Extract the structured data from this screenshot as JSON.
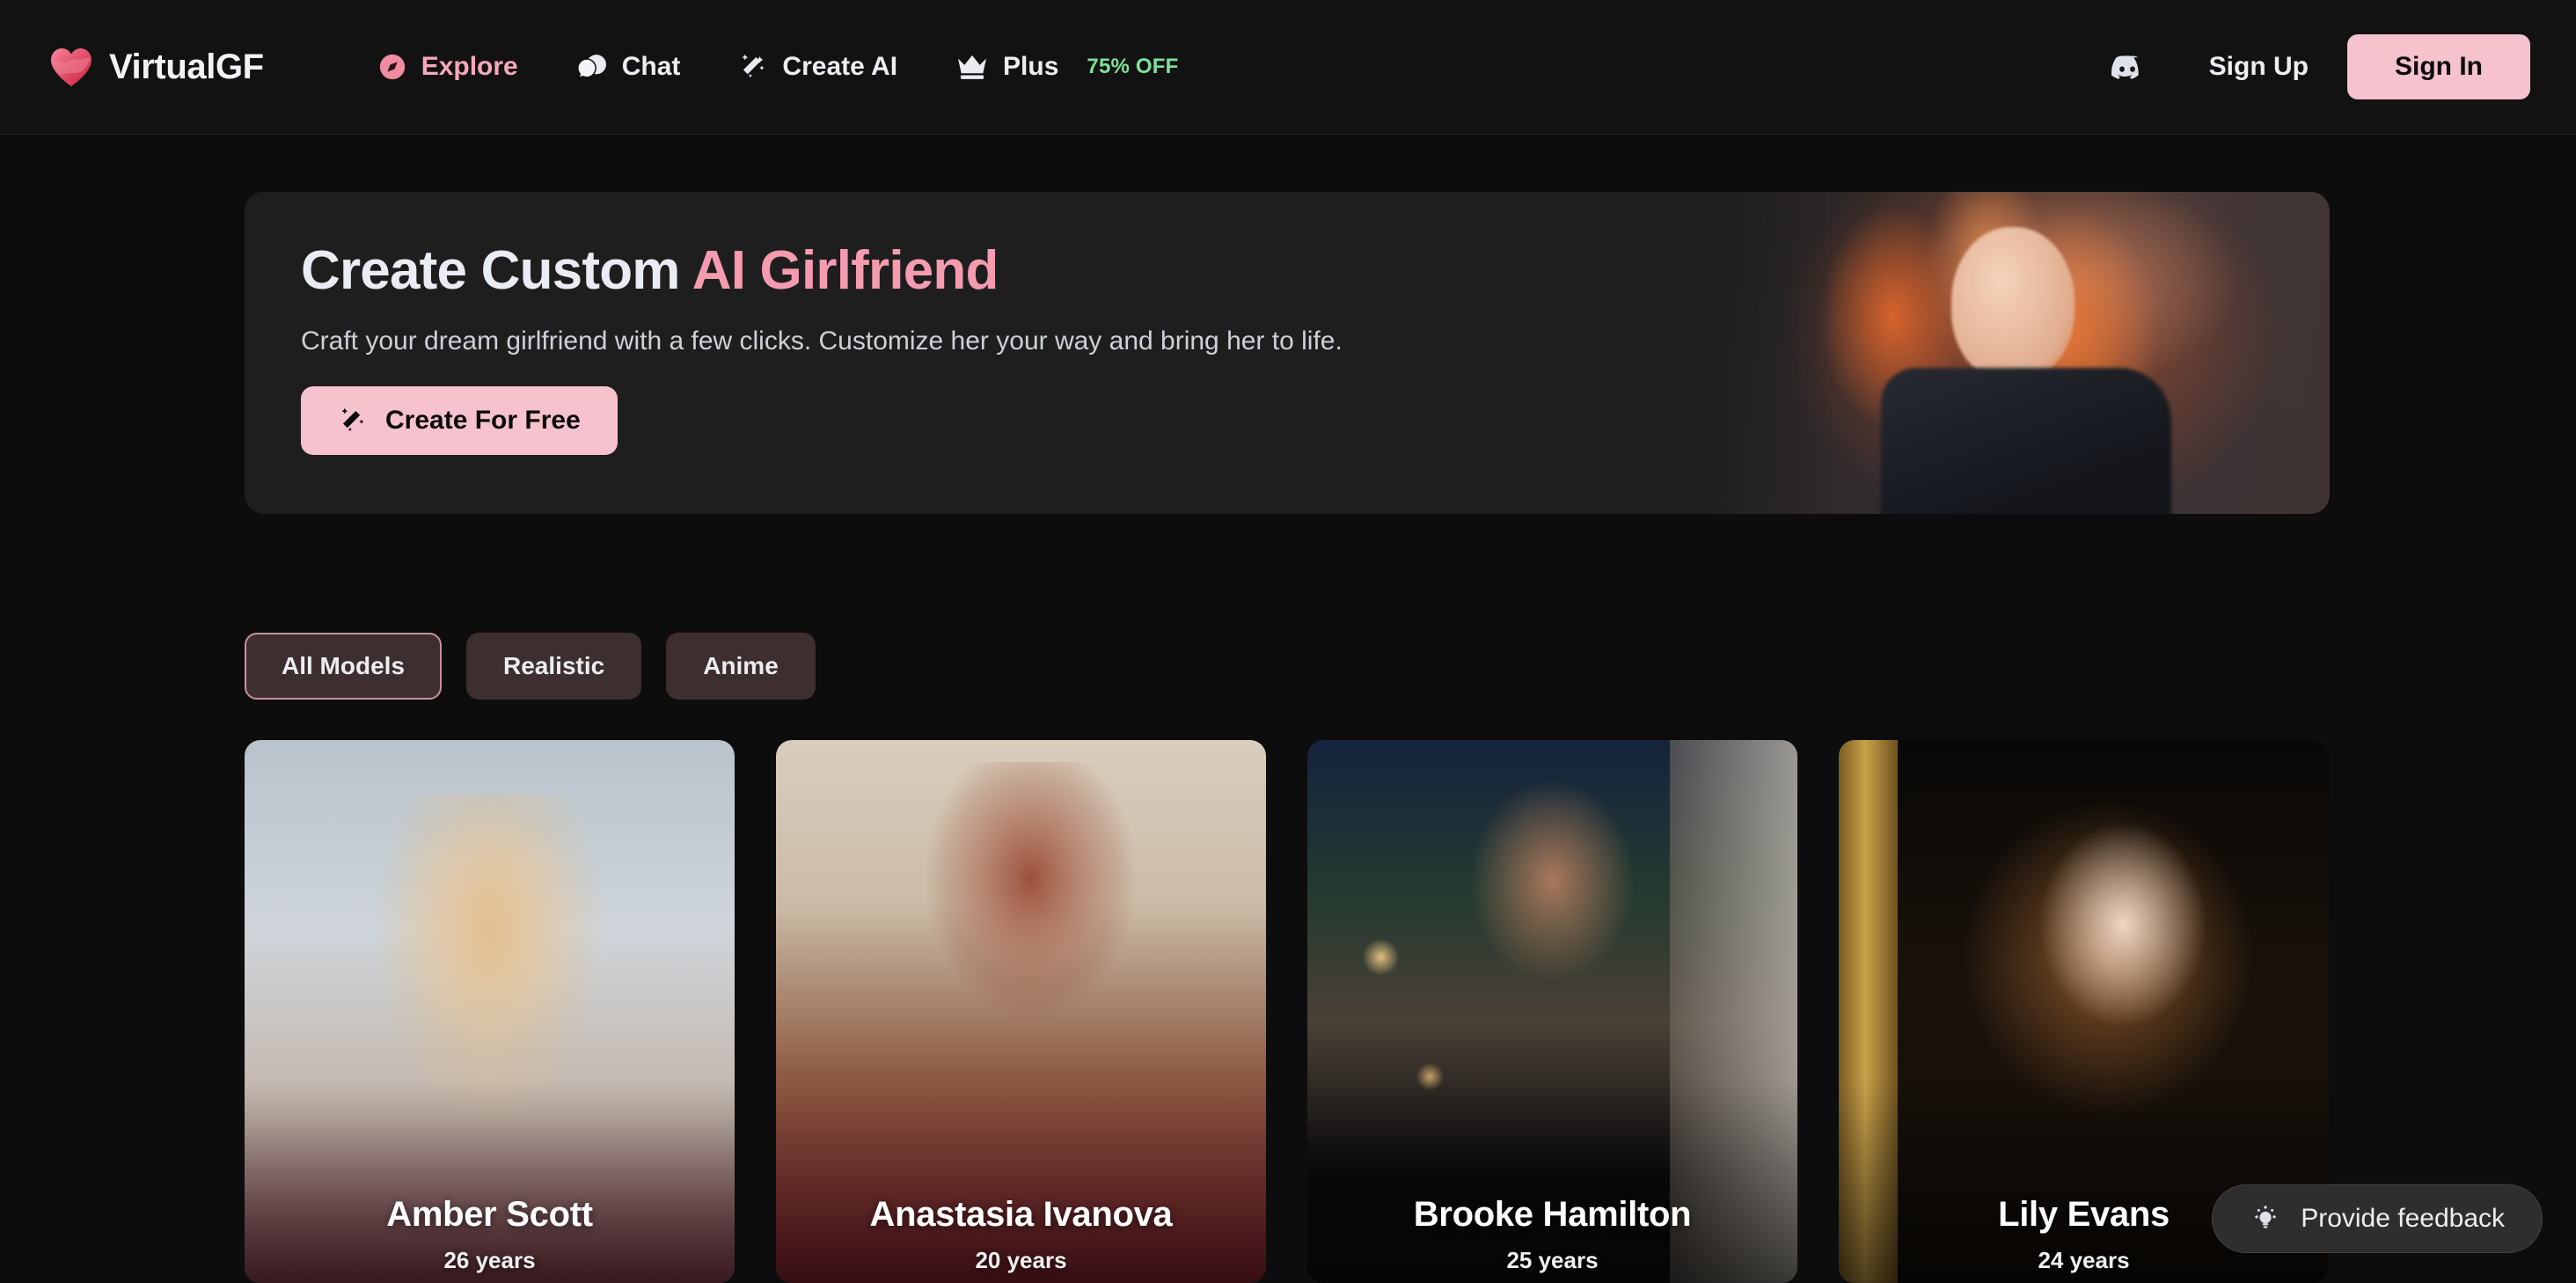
{
  "brand": {
    "name": "VirtualGF",
    "logo_icon": "heart-logo-icon"
  },
  "nav": {
    "items": [
      {
        "label": "Explore",
        "icon": "compass-icon",
        "accent": true
      },
      {
        "label": "Chat",
        "icon": "chat-bubble-icon",
        "accent": false
      },
      {
        "label": "Create AI",
        "icon": "magic-wand-icon",
        "accent": false
      },
      {
        "label": "Plus",
        "icon": "crown-icon",
        "accent": false,
        "badge": "75% OFF"
      }
    ]
  },
  "header_right": {
    "discord_icon": "discord-icon",
    "sign_up": "Sign Up",
    "sign_in": "Sign In"
  },
  "hero": {
    "title_plain": "Create Custom ",
    "title_accent": "AI Girlfriend",
    "subtitle": "Craft your dream girlfriend with a few clicks. Customize her your way and bring her to life.",
    "cta_label": "Create For Free",
    "cta_icon": "magic-wand-icon"
  },
  "filters": {
    "items": [
      {
        "label": "All Models",
        "active": true
      },
      {
        "label": "Realistic",
        "active": false
      },
      {
        "label": "Anime",
        "active": false
      }
    ]
  },
  "models": [
    {
      "name": "Amber Scott",
      "age": "26 years"
    },
    {
      "name": "Anastasia Ivanova",
      "age": "20 years"
    },
    {
      "name": "Brooke Hamilton",
      "age": "25 years"
    },
    {
      "name": "Lily Evans",
      "age": "24 years"
    }
  ],
  "feedback": {
    "label": "Provide feedback",
    "icon": "lightbulb-icon"
  },
  "colors": {
    "accent_pink": "#f6c2ce",
    "accent_pink_text": "#f49bb0",
    "promo_green": "#7ee29a",
    "page_bg": "#0d0d0d",
    "surface": "#1e1e1e",
    "pill_bg": "#3d2f2f"
  }
}
